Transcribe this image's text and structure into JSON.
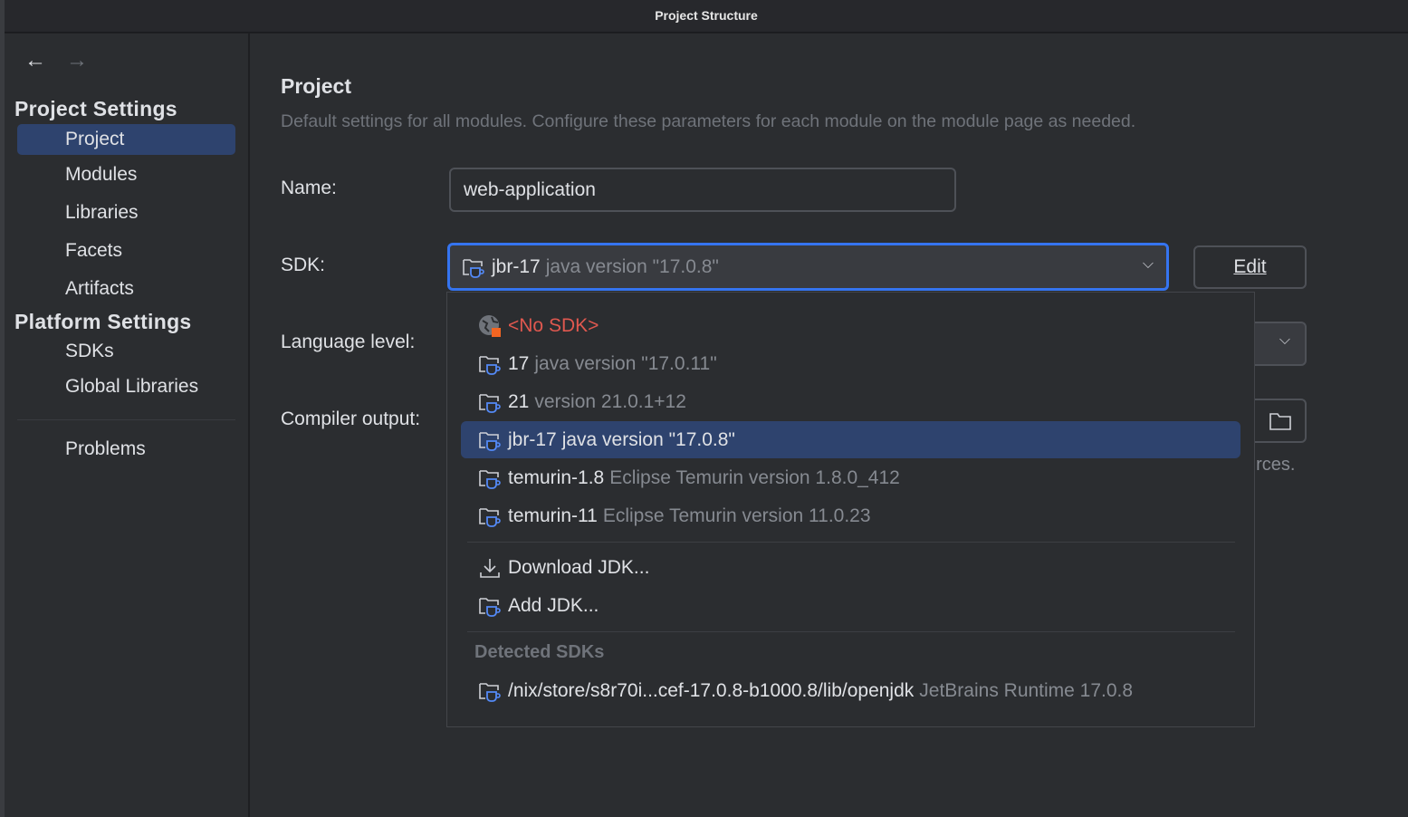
{
  "window": {
    "title": "Project Structure"
  },
  "sidebar": {
    "project_settings": "Project Settings",
    "project_items": [
      "Project",
      "Modules",
      "Libraries",
      "Facets",
      "Artifacts"
    ],
    "platform_settings": "Platform Settings",
    "platform_items": [
      "SDKs",
      "Global Libraries"
    ],
    "problems": "Problems",
    "selected": "Project"
  },
  "main": {
    "title": "Project",
    "description": "Default settings for all modules. Configure these parameters for each module on the module page as needed.",
    "name_label": "Name:",
    "name_value": "web-application",
    "sdk_label": "SDK:",
    "sdk_name": "jbr-17",
    "sdk_version": "java version \"17.0.8\"",
    "edit_label": "Edit",
    "language_label": "Language level:",
    "compiler_label": "Compiler output:",
    "compiler_hint_partial": "urces."
  },
  "dropdown": {
    "no_sdk": "<No SDK>",
    "sdks": [
      {
        "name": "17",
        "detail": "java version \"17.0.11\""
      },
      {
        "name": "21",
        "detail": "version 21.0.1+12"
      },
      {
        "name": "jbr-17",
        "detail": "java version \"17.0.8\"",
        "selected": true
      },
      {
        "name": "temurin-1.8",
        "detail": "Eclipse Temurin version 1.8.0_412"
      },
      {
        "name": "temurin-11",
        "detail": "Eclipse Temurin version 11.0.23"
      }
    ],
    "download": "Download JDK...",
    "add": "Add JDK...",
    "detected_header": "Detected SDKs",
    "detected": [
      {
        "name": "/nix/store/s8r70i...cef-17.0.8-b1000.8/lib/openjdk",
        "detail": "JetBrains Runtime 17.0.8"
      }
    ]
  },
  "colors": {
    "accent": "#3574f0",
    "selection": "#2e436e",
    "error": "#e0584f",
    "background": "#2b2d30"
  }
}
